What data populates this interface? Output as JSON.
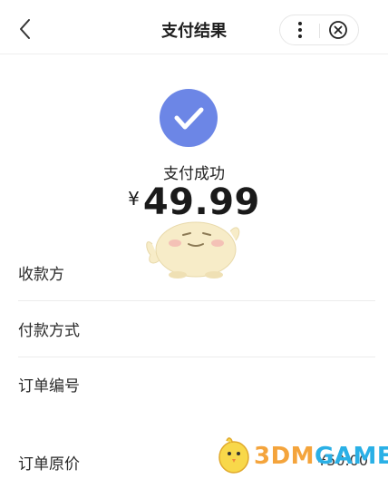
{
  "nav": {
    "title": "支付结果"
  },
  "result": {
    "status": "支付成功",
    "currency": "¥",
    "amount": "49.99"
  },
  "details": [
    {
      "label": "收款方"
    },
    {
      "label": "付款方式"
    },
    {
      "label": "订单编号"
    },
    {
      "label": "订单原价",
      "value": "¥50.00"
    }
  ],
  "watermark": {
    "text_prefix": "3DM",
    "text_suffix": "GAME"
  },
  "colors": {
    "success": "#6c86e6",
    "watermark_orange": "#f4a43c",
    "watermark_blue": "#2ab0e6"
  },
  "icons": {
    "back": "chevron-left-icon",
    "more": "more-vertical-icon",
    "close": "close-circle-icon",
    "success": "check-circle-icon"
  }
}
